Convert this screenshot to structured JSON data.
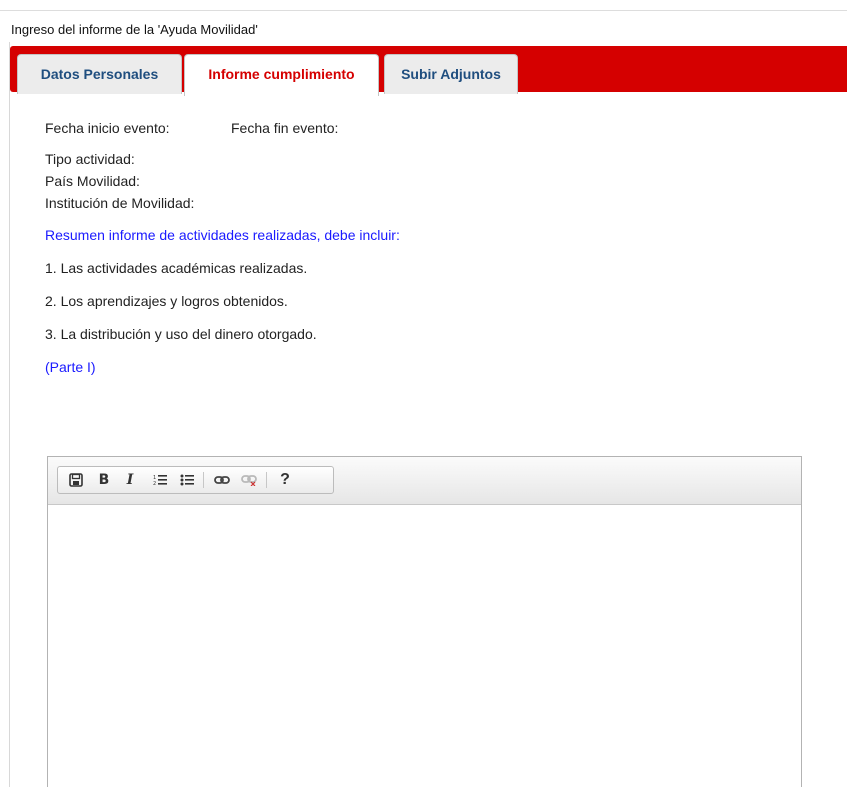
{
  "window": {
    "title": "Ingreso del informe de la 'Ayuda Movilidad'"
  },
  "tabs": [
    {
      "label": "Datos Personales",
      "active": false
    },
    {
      "label": "Informe cumplimiento",
      "active": true
    },
    {
      "label": "Subir Adjuntos",
      "active": false
    }
  ],
  "colors": {
    "accent_red": "#d50000",
    "tab_text_blue": "#1f4e7f",
    "link_blue": "#1a1aff"
  },
  "event_info": {
    "fecha_inicio_label": "Fecha inicio evento:",
    "fecha_fin_label": "Fecha fin evento:",
    "tipo_actividad_label": "Tipo actividad:",
    "pais_label": "País Movilidad:",
    "institucion_label": "Institución de Movilidad:"
  },
  "summary": {
    "heading": "Resumen informe de actividades realizadas, debe incluir:",
    "items": [
      "1. Las actividades académicas realizadas.",
      "2. Los aprendizajes y logros obtenidos.",
      "3. La distribución y uso del dinero otorgado."
    ],
    "part_label": "(Parte I)"
  },
  "editor": {
    "content": "",
    "toolbar": [
      {
        "name": "save-icon",
        "glyph": "🖫"
      },
      {
        "name": "bold-icon",
        "glyph": "B"
      },
      {
        "name": "italic-icon",
        "glyph": "I"
      },
      {
        "name": "numbered-list-icon",
        "glyph": "⒈"
      },
      {
        "name": "bulleted-list-icon",
        "glyph": "•"
      },
      {
        "name": "link-icon",
        "glyph": "∞"
      },
      {
        "name": "unlink-icon",
        "glyph": "∞"
      },
      {
        "name": "help-icon",
        "glyph": "?"
      }
    ]
  }
}
